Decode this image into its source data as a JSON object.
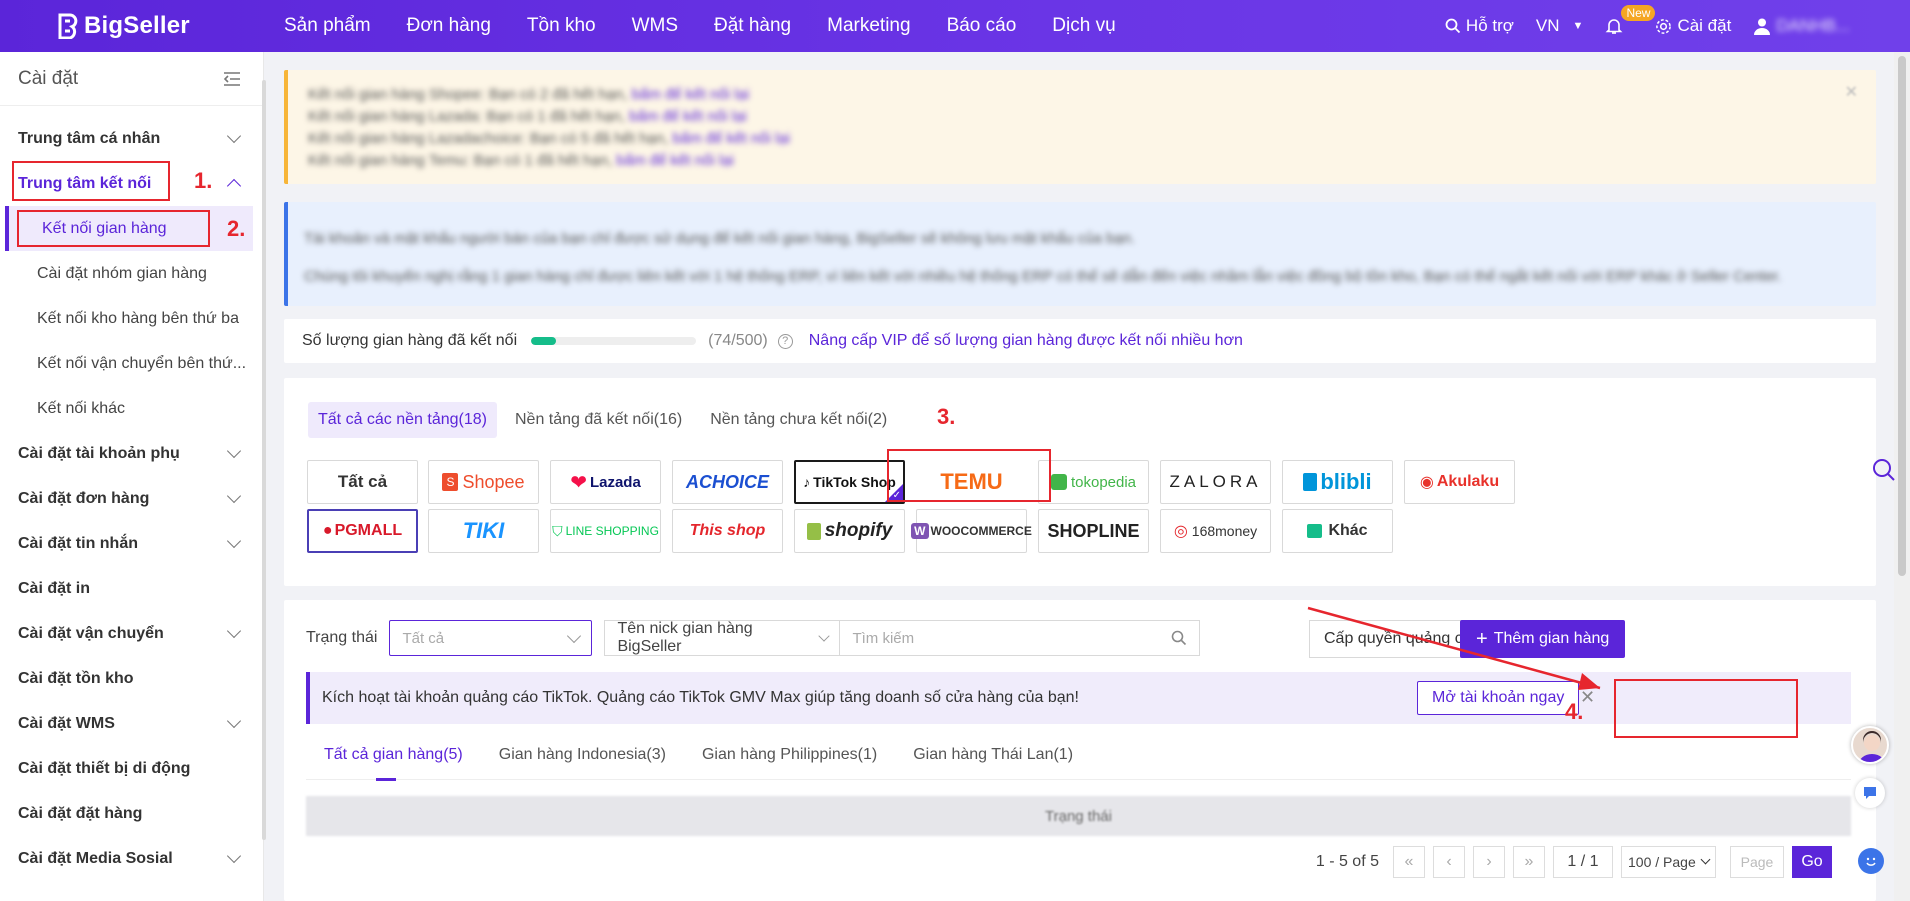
{
  "nav": {
    "brand": "BigSeller",
    "items": [
      "Sản phẩm",
      "Đơn hàng",
      "Tồn kho",
      "WMS",
      "Đặt hàng",
      "Marketing",
      "Báo cáo",
      "Dịch vụ"
    ],
    "support": "Hỗ trợ",
    "lang": "VN",
    "new_badge": "New",
    "settings": "Cài đặt",
    "user": "DANHB..."
  },
  "sidebar": {
    "title": "Cài đặt",
    "items": [
      {
        "label": "Trung tâm cá nhân"
      },
      {
        "label": "Trung tâm kết nối"
      },
      {
        "label": "Kết nối gian hàng"
      },
      {
        "label": "Cài đặt nhóm gian hàng"
      },
      {
        "label": "Kết nối kho hàng bên thứ ba"
      },
      {
        "label": "Kết nối vận chuyển bên thứ..."
      },
      {
        "label": "Kết nối khác"
      },
      {
        "label": "Cài đặt tài khoản phụ"
      },
      {
        "label": "Cài đặt đơn hàng"
      },
      {
        "label": "Cài đặt tin nhắn"
      },
      {
        "label": "Cài đặt in"
      },
      {
        "label": "Cài đặt vận chuyển"
      },
      {
        "label": "Cài đặt tồn kho"
      },
      {
        "label": "Cài đặt WMS"
      },
      {
        "label": "Cài đặt thiết bị di động"
      },
      {
        "label": "Cài đặt đặt hàng"
      },
      {
        "label": "Cài đặt Media Sosial"
      }
    ]
  },
  "steps": {
    "s1": "1.",
    "s2": "2.",
    "s3": "3.",
    "s4": "4."
  },
  "warning": {
    "lines": [
      {
        "text": "Kết nối gian hàng Shopee: Bạn có 2 đã hết hạn, ",
        "link": "bấm để kết nối lại"
      },
      {
        "text": "Kết nối gian hàng Lazada: Bạn có 1 đã hết hạn, ",
        "link": "bấm để kết nối lại"
      },
      {
        "text": "Kết nối gian hàng Lazadachoice: Bạn có 5 đã hết hạn, ",
        "link": "bấm để kết nối lại"
      },
      {
        "text": "Kết nối gian hàng Temu: Bạn có 1 đã hết hạn, ",
        "link": "bấm để kết nối lại"
      }
    ]
  },
  "info": {
    "line1": "Tài khoản và mật khẩu người bán của bạn chỉ được sử dụng để kết nối gian hàng, BigSeller sẽ không lưu mật khẩu của bạn.",
    "line2": "Chúng tôi khuyến nghị rằng 1 gian hàng chỉ được liên kết với 1 hệ thống ERP, vì liên kết với nhiều hệ thống ERP có thể sẽ dẫn đến việc nhầm lẫn việc đồng bộ tồn kho, Bạn có thể ngắt kết nối với ERP khác ở Seller Center."
  },
  "count": {
    "label": "Số lượng gian hàng đã kết nối",
    "value": "(74/500)",
    "progress": 0.148,
    "help": "?",
    "upgrade": "Nâng cấp VIP để số lượng gian hàng được kết nối nhiều hơn"
  },
  "platform_tabs": [
    "Tất cả các nền tảng(18)",
    "Nền tảng đã kết nối(16)",
    "Nền tảng chưa kết nối(2)"
  ],
  "platforms": [
    "Tất cả",
    "Shopee",
    "Lazada",
    "ACHOICE",
    "TikTok Shop",
    "TEMU",
    "tokopedia",
    "ZALORA",
    "blibli",
    "Akulaku",
    "PGMALL",
    "TIKI",
    "LINE SHOPPING",
    "This shop",
    "shopify",
    "WOOCOMMERCE",
    "SHOPLINE",
    "168money",
    "Khác"
  ],
  "filter": {
    "status_label": "Trạng thái",
    "status_placeholder": "Tất cả",
    "nick_select": "Tên nick gian hàng BigSeller",
    "search_placeholder": "Tìm kiếm",
    "ads_btn": "Cấp quyền quảng cáo",
    "add_btn": "Thêm gian hàng"
  },
  "ad": {
    "text": "Kích hoạt tài khoản quảng cáo TikTok. Quảng cáo TikTok GMV Max giúp tăng doanh số cửa hàng của bạn!",
    "btn": "Mở tài khoản ngay"
  },
  "store_tabs": [
    "Tất cả gian hàng(5)",
    "Gian hàng Indonesia(3)",
    "Gian hàng Philippines(1)",
    "Gian hàng Thái Lan(1)"
  ],
  "table": {
    "header": "Trạng thái"
  },
  "pager": {
    "range": "1 - 5 of 5",
    "page": "1 / 1",
    "size": "100 / Page",
    "page_ph": "Page",
    "go": "Go"
  },
  "colors": {
    "primary": "#5b25d9",
    "red": "#e6262e",
    "warn": "#f7b538",
    "info": "#3c74e8"
  }
}
